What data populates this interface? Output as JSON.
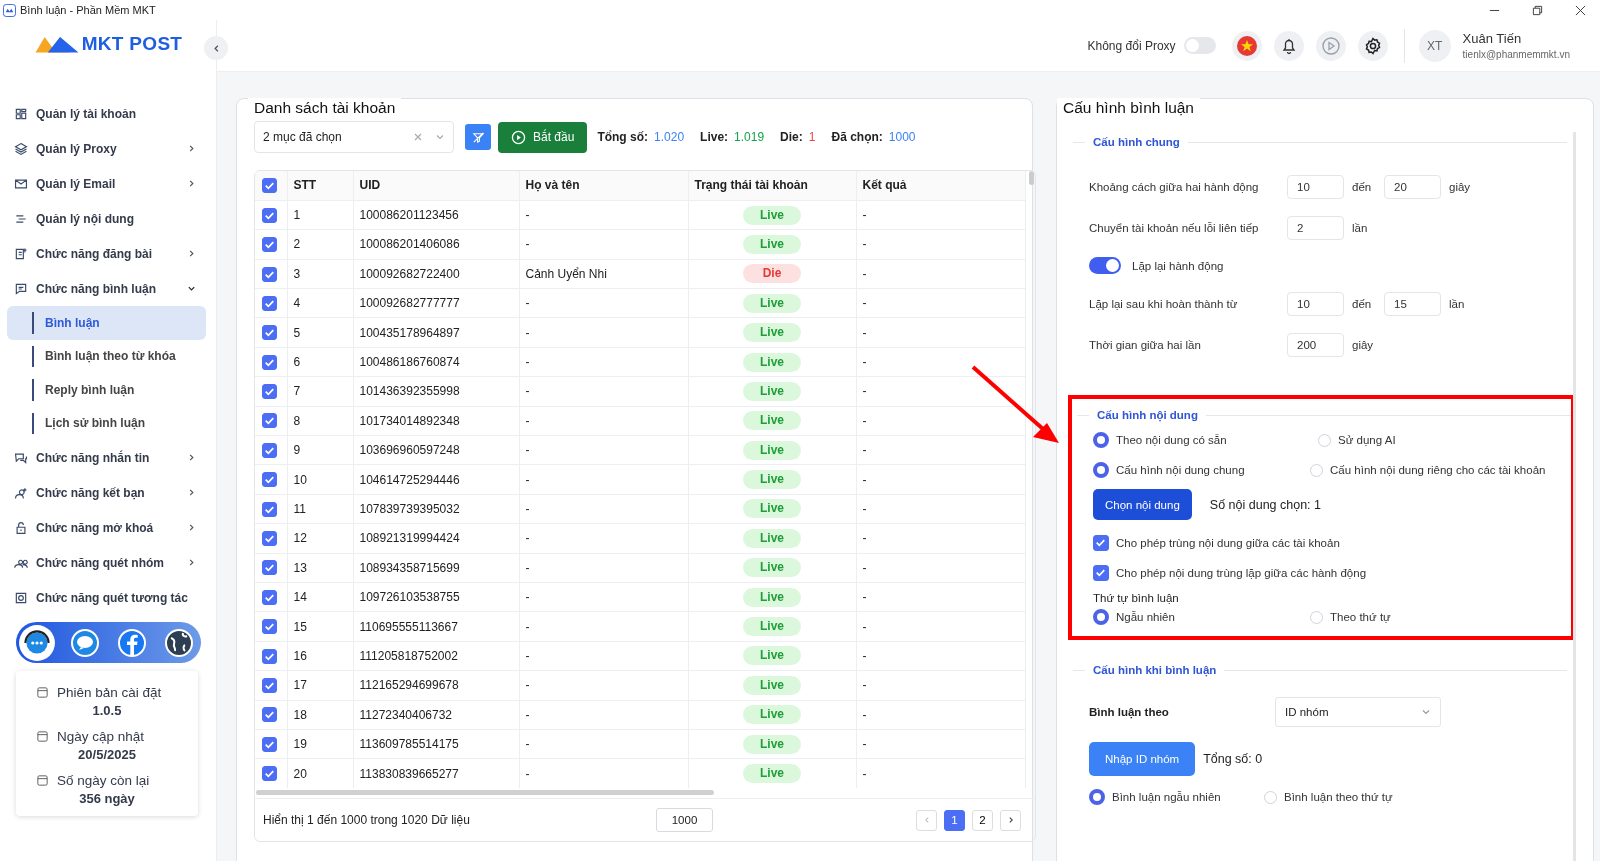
{
  "window": {
    "title": "Bình luận - Phần Mềm MKT"
  },
  "logo": {
    "text": "MKT POST"
  },
  "sidebar": {
    "items": [
      {
        "label": "Quản lý tài khoản",
        "kind": "link"
      },
      {
        "label": "Quản lý Proxy",
        "kind": "group",
        "expanded": false
      },
      {
        "label": "Quản lý Email",
        "kind": "group",
        "expanded": false
      },
      {
        "label": "Quản lý nội dung",
        "kind": "link"
      },
      {
        "label": "Chức năng đăng bài",
        "kind": "group",
        "expanded": false
      },
      {
        "label": "Chức năng bình luận",
        "kind": "group",
        "expanded": true,
        "children": [
          {
            "label": "Bình luận",
            "selected": true
          },
          {
            "label": "Bình luận theo từ khóa",
            "selected": false
          },
          {
            "label": "Reply bình luận",
            "selected": false
          },
          {
            "label": "Lịch sử bình luận",
            "selected": false
          }
        ]
      },
      {
        "label": "Chức năng nhắn tin",
        "kind": "group",
        "expanded": false
      },
      {
        "label": "Chức năng kết bạn",
        "kind": "group",
        "expanded": false
      },
      {
        "label": "Chức năng mở khoá",
        "kind": "group",
        "expanded": false
      },
      {
        "label": "Chức năng quét nhóm",
        "kind": "group",
        "expanded": false
      },
      {
        "label": "Chức năng quét tương tác",
        "kind": "link"
      }
    ],
    "info": [
      {
        "label": "Phiên bản cài đặt",
        "value": "1.0.5"
      },
      {
        "label": "Ngày cập nhật",
        "value": "20/5/2025"
      },
      {
        "label": "Số ngày còn lại",
        "value": "356 ngày"
      }
    ]
  },
  "header": {
    "proxy_label": "Không đổi Proxy",
    "proxy_on": false,
    "user": {
      "initials": "XT",
      "name": "Xuân Tiến",
      "email": "tienlx@phanmemmkt.vn"
    }
  },
  "accounts": {
    "title": "Danh sách tài khoản",
    "filter_value": "2 mục đã chọn",
    "start_button": "Bắt đầu",
    "stats": [
      {
        "label": "Tổng số:",
        "value": "1.020",
        "color": "#3b82f6"
      },
      {
        "label": "Live:",
        "value": "1.019",
        "color": "#16a34a"
      },
      {
        "label": "Die:",
        "value": "1",
        "color": "#ef4444"
      },
      {
        "label": "Đã chọn:",
        "value": "1000",
        "color": "#3b82f6"
      }
    ],
    "all_checked": true,
    "columns": [
      "STT",
      "UID",
      "Họ và tên",
      "Trạng thái tài khoản",
      "Kết quả"
    ],
    "rows": [
      {
        "checked": true,
        "stt": "1",
        "uid": "100086201123456",
        "name": "-",
        "status": "Live",
        "kind": "live",
        "result": "-"
      },
      {
        "checked": true,
        "stt": "2",
        "uid": "100086201406086",
        "name": "-",
        "status": "Live",
        "kind": "live",
        "result": "-"
      },
      {
        "checked": true,
        "stt": "3",
        "uid": "100092682722400",
        "name": "Cảnh Uyển Nhi",
        "status": "Die",
        "kind": "die",
        "result": "-"
      },
      {
        "checked": true,
        "stt": "4",
        "uid": "100092682777777",
        "name": "-",
        "status": "Live",
        "kind": "live",
        "result": "-"
      },
      {
        "checked": true,
        "stt": "5",
        "uid": "100435178964897",
        "name": "-",
        "status": "Live",
        "kind": "live",
        "result": "-"
      },
      {
        "checked": true,
        "stt": "6",
        "uid": "100486186760874",
        "name": "-",
        "status": "Live",
        "kind": "live",
        "result": "-"
      },
      {
        "checked": true,
        "stt": "7",
        "uid": "101436392355998",
        "name": "-",
        "status": "Live",
        "kind": "live",
        "result": "-"
      },
      {
        "checked": true,
        "stt": "8",
        "uid": "101734014892348",
        "name": "-",
        "status": "Live",
        "kind": "live",
        "result": "-"
      },
      {
        "checked": true,
        "stt": "9",
        "uid": "103696960597248",
        "name": "-",
        "status": "Live",
        "kind": "live",
        "result": "-"
      },
      {
        "checked": true,
        "stt": "10",
        "uid": "104614725294446",
        "name": "-",
        "status": "Live",
        "kind": "live",
        "result": "-"
      },
      {
        "checked": true,
        "stt": "11",
        "uid": "107839739395032",
        "name": "-",
        "status": "Live",
        "kind": "live",
        "result": "-"
      },
      {
        "checked": true,
        "stt": "12",
        "uid": "108921319994424",
        "name": "-",
        "status": "Live",
        "kind": "live",
        "result": "-"
      },
      {
        "checked": true,
        "stt": "13",
        "uid": "108934358715699",
        "name": "-",
        "status": "Live",
        "kind": "live",
        "result": "-"
      },
      {
        "checked": true,
        "stt": "14",
        "uid": "109726103538755",
        "name": "-",
        "status": "Live",
        "kind": "live",
        "result": "-"
      },
      {
        "checked": true,
        "stt": "15",
        "uid": "110695555113667",
        "name": "-",
        "status": "Live",
        "kind": "live",
        "result": "-"
      },
      {
        "checked": true,
        "stt": "16",
        "uid": "111205818752002",
        "name": "-",
        "status": "Live",
        "kind": "live",
        "result": "-"
      },
      {
        "checked": true,
        "stt": "17",
        "uid": "112165294699678",
        "name": "-",
        "status": "Live",
        "kind": "live",
        "result": "-"
      },
      {
        "checked": true,
        "stt": "18",
        "uid": "11272340406732",
        "name": "-",
        "status": "Live",
        "kind": "live",
        "result": "-"
      },
      {
        "checked": true,
        "stt": "19",
        "uid": "113609785514175",
        "name": "-",
        "status": "Live",
        "kind": "live",
        "result": "-"
      },
      {
        "checked": true,
        "stt": "20",
        "uid": "113830839665277",
        "name": "-",
        "status": "Live",
        "kind": "live",
        "result": "-"
      }
    ],
    "footer_text": "Hiển thị 1 đến 1000 trong 1020 Dữ liệu",
    "page_size": "1000",
    "pages": [
      {
        "label": "1",
        "selected": true
      },
      {
        "label": "2",
        "selected": false
      }
    ]
  },
  "config": {
    "title": "Cấu hình bình luận",
    "general": {
      "title": "Cấu hình chung",
      "rows": [
        {
          "kind": "range",
          "label": "Khoảng cách giữa hai hành động",
          "from": "10",
          "middle": "đến",
          "to": "20",
          "unit": "giây"
        },
        {
          "kind": "single",
          "label": "Chuyển tài khoản nếu lỗi liên tiếp",
          "value": "2",
          "unit": "lần"
        },
        {
          "kind": "toggle",
          "label": "Lặp lại hành động",
          "on": true
        },
        {
          "kind": "range",
          "label": "Lặp lại sau khi hoàn thành từ",
          "from": "10",
          "middle": "đến",
          "to": "15",
          "unit": "lần"
        },
        {
          "kind": "single",
          "label": "Thời gian giữa hai lần",
          "value": "200",
          "unit": "giây"
        }
      ]
    },
    "content": {
      "title": "Cấu hình nội dung",
      "source_options": [
        {
          "label": "Theo nội dung có sẵn",
          "selected": true
        },
        {
          "label": "Sử dụng AI",
          "selected": false
        }
      ],
      "scope_options": [
        {
          "label": "Cấu hình nội dung chung",
          "selected": true
        },
        {
          "label": "Cấu hình nội dung riêng cho các tài khoản",
          "selected": false
        }
      ],
      "choose_button": "Chọn nội dung",
      "count_text": "Số nội dung chọn: 1",
      "checks": [
        {
          "label": "Cho phép trùng nội dung giữa các tài khoản",
          "checked": true
        },
        {
          "label": "Cho phép nội dung trùng lặp giữa các hành động",
          "checked": true
        }
      ],
      "order_label": "Thứ tự bình luận",
      "order_options": [
        {
          "label": "Ngẫu nhiên",
          "selected": true
        },
        {
          "label": "Theo thứ tự",
          "selected": false
        }
      ]
    },
    "on_comment": {
      "title": "Cấu hình khi bình luận",
      "by_label": "Bình luận theo",
      "by_value": "ID nhóm",
      "import_button": "Nhập ID nhóm",
      "total_text": "Tổng số: 0",
      "order_options": [
        {
          "label": "Bình luận ngẫu nhiên",
          "selected": true
        },
        {
          "label": "Bình luận theo thứ tự",
          "selected": false
        }
      ]
    }
  }
}
